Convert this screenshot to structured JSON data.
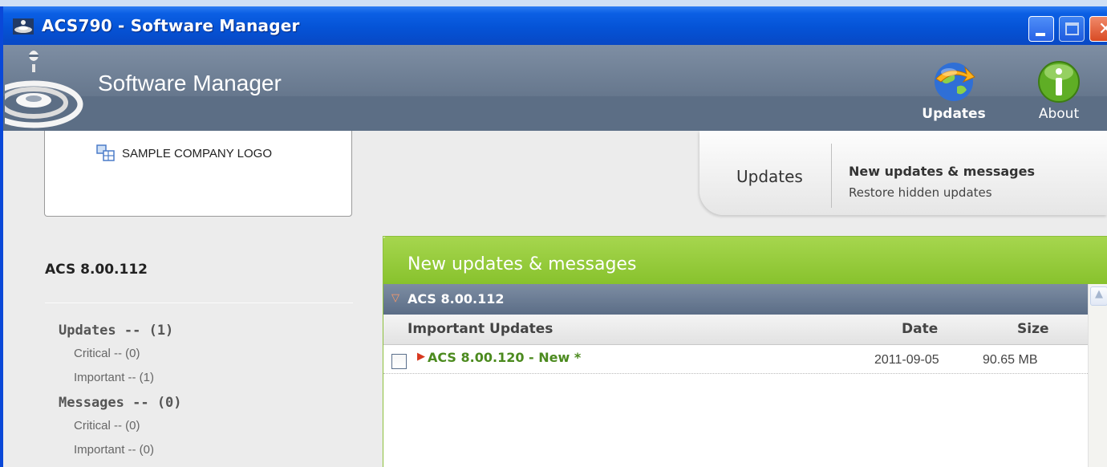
{
  "window": {
    "title": "ACS790 - Software Manager",
    "controls": {
      "minimize": "minimize",
      "maximize": "maximize",
      "close": "close"
    }
  },
  "header": {
    "app_title": "Software Manager",
    "buttons": [
      {
        "label": "Updates",
        "icon": "globe-update-icon"
      },
      {
        "label": "About",
        "icon": "info-icon"
      }
    ]
  },
  "sidebar": {
    "company_logo_text": "SAMPLE COMPANY LOGO",
    "version": "ACS 8.00.112",
    "tree": [
      {
        "label": "Updates -- (1)",
        "children": [
          {
            "label": "Critical -- (0)"
          },
          {
            "label": "Important -- (1)"
          }
        ]
      },
      {
        "label": "Messages -- (0)",
        "children": [
          {
            "label": "Critical -- (0)"
          },
          {
            "label": "Important -- (0)"
          }
        ]
      }
    ]
  },
  "tabs": {
    "section_title": "Updates",
    "links": [
      "New updates & messages",
      "Restore hidden updates"
    ]
  },
  "panel": {
    "title": "New updates & messages",
    "group": "ACS 8.00.112",
    "columns": [
      "Important Updates",
      "Date",
      "Size"
    ],
    "items": [
      {
        "name": "ACS 8.00.120 - New *",
        "date": "2011-09-05",
        "size": "90.65 MB",
        "checked": false
      }
    ]
  },
  "colors": {
    "titlebar": "#0553d6",
    "header": "#5c6e85",
    "panel_header": "#88c22d",
    "item_name": "#4b8a1e"
  }
}
